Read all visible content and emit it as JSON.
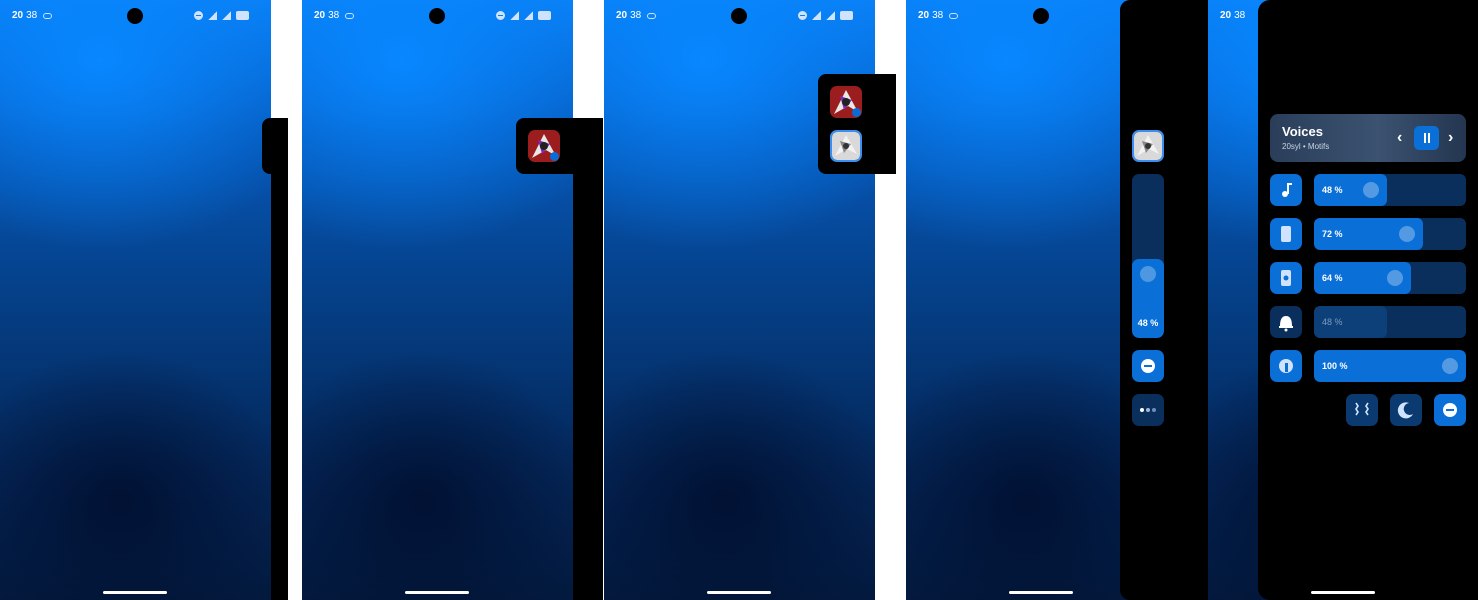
{
  "status_bar": {
    "hour": "20",
    "minute": "38"
  },
  "frame4": {
    "volume_percent_label": "48 %",
    "volume_level": 0.48
  },
  "frame5": {
    "media": {
      "title": "Voices",
      "subtitle": "20syl • Motifs",
      "prev": "‹",
      "next": "›"
    },
    "sliders": [
      {
        "name": "media",
        "icon": "music-note-icon",
        "label": "48 %",
        "level": 0.48,
        "active": true
      },
      {
        "name": "ring",
        "icon": "phone-icon",
        "label": "72 %",
        "level": 0.72,
        "active": true
      },
      {
        "name": "notification",
        "icon": "notification-phone-icon",
        "label": "64 %",
        "level": 0.64,
        "active": true
      },
      {
        "name": "alarm",
        "icon": "bell-icon",
        "label": "48 %",
        "level": 0.48,
        "active": false
      },
      {
        "name": "call",
        "icon": "call-speaker-icon",
        "label": "100 %",
        "level": 1.0,
        "active": true
      }
    ],
    "quick_buttons": [
      "vibrate-icon",
      "moon-icon",
      "dnd-icon"
    ]
  },
  "colors": {
    "accent": "#0a6fd6",
    "track": "#0a2f5c",
    "panel": "#000000"
  }
}
